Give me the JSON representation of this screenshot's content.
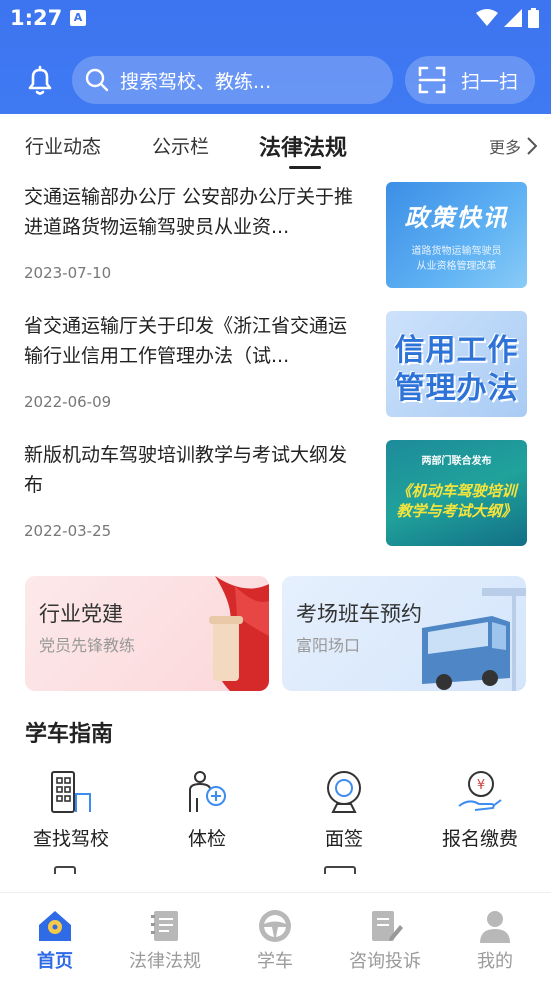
{
  "status": {
    "time": "1:27",
    "notif_glyph": "A"
  },
  "header": {
    "search_placeholder": "搜索驾校、教练...",
    "scan_label": "扫一扫"
  },
  "tabs": [
    {
      "label": "行业动态",
      "active": false
    },
    {
      "label": "公示栏",
      "active": false
    },
    {
      "label": "法律法规",
      "active": true
    }
  ],
  "more_label": "更多",
  "news": [
    {
      "title": "交通运输部办公厅 公安部办公厅关于推进道路货物运输驾驶员从业资...",
      "date": "2023-07-10",
      "thumb": {
        "headline": "政策快讯",
        "sub1": "道路货物运输驾驶员",
        "sub2": "从业资格管理改革"
      }
    },
    {
      "title": "省交通运输厅关于印发《浙江省交通运输行业信用工作管理办法（试...",
      "date": "2022-06-09",
      "thumb": {
        "line1": "信用工作",
        "line2": "管理办法"
      }
    },
    {
      "title": "新版机动车驾驶培训教学与考试大纲发布",
      "date": "2022-03-25",
      "thumb": {
        "header": "两部门联合发布",
        "line1": "《机动车驾驶培训",
        "line2": "教学与考试大纲》"
      }
    }
  ],
  "cards": [
    {
      "title": "行业党建",
      "subtitle": "党员先锋教练"
    },
    {
      "title": "考场班车预约",
      "subtitle": "富阳场口"
    }
  ],
  "guide": {
    "title": "学车指南",
    "items": [
      {
        "label": "查找驾校",
        "icon": "building-icon"
      },
      {
        "label": "体检",
        "icon": "health-check-icon"
      },
      {
        "label": "面签",
        "icon": "camera-icon"
      },
      {
        "label": "报名缴费",
        "icon": "payment-icon"
      }
    ]
  },
  "nav": [
    {
      "label": "首页",
      "icon": "home-icon",
      "active": true
    },
    {
      "label": "法律法规",
      "icon": "book-icon",
      "active": false
    },
    {
      "label": "学车",
      "icon": "steering-wheel-icon",
      "active": false
    },
    {
      "label": "咨询投诉",
      "icon": "edit-doc-icon",
      "active": false
    },
    {
      "label": "我的",
      "icon": "user-icon",
      "active": false
    }
  ],
  "colors": {
    "primary": "#3d74ef",
    "active_nav": "#2f6be6",
    "gray": "#9a9a9a"
  }
}
